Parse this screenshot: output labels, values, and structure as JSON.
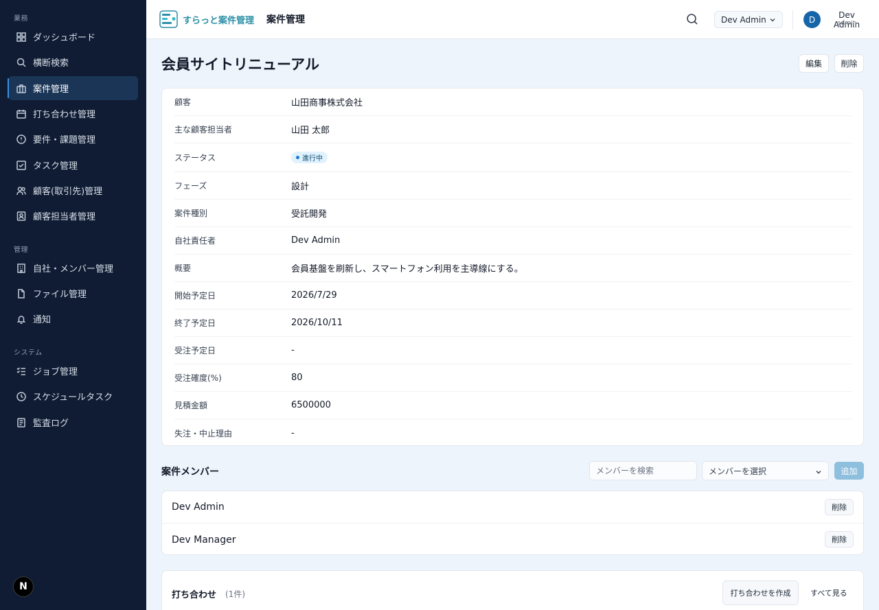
{
  "sidebar": {
    "sections": [
      {
        "label": "業務"
      },
      {
        "label": "管理"
      },
      {
        "label": "システム"
      }
    ],
    "items": [
      {
        "label": "ダッシュボード",
        "icon": "dashboard-icon"
      },
      {
        "label": "横断検索",
        "icon": "search-icon"
      },
      {
        "label": "案件管理",
        "icon": "briefcase-icon",
        "active": true
      },
      {
        "label": "打ち合わせ管理",
        "icon": "calendar-icon"
      },
      {
        "label": "要件・課題管理",
        "icon": "alert-circle-icon"
      },
      {
        "label": "タスク管理",
        "icon": "checkbox-icon"
      },
      {
        "label": "顧客(取引先)管理",
        "icon": "users-icon"
      },
      {
        "label": "顧客担当者管理",
        "icon": "contact-icon"
      },
      {
        "label": "自社・メンバー管理",
        "icon": "building-icon"
      },
      {
        "label": "ファイル管理",
        "icon": "file-icon"
      },
      {
        "label": "通知",
        "icon": "bell-icon"
      },
      {
        "label": "ジョブ管理",
        "icon": "list-check-icon"
      },
      {
        "label": "スケジュールタスク",
        "icon": "clock-icon"
      },
      {
        "label": "監査ログ",
        "icon": "log-icon"
      }
    ],
    "footer_badge": "N"
  },
  "header": {
    "logo_text": "すらっと案件管理",
    "title": "案件管理",
    "user_select": "Dev Admin",
    "avatar_initial": "D",
    "user_name": "Dev Admin",
    "user_role": "admin"
  },
  "page": {
    "title": "会員サイトリニューアル",
    "edit_label": "編集",
    "delete_label": "削除"
  },
  "details": [
    {
      "label": "顧客",
      "value": "山田商事株式会社"
    },
    {
      "label": "主な顧客担当者",
      "value": "山田 太郎"
    },
    {
      "label": "ステータス",
      "value": "進行中",
      "badge": true
    },
    {
      "label": "フェーズ",
      "value": "設計"
    },
    {
      "label": "案件種別",
      "value": "受託開発"
    },
    {
      "label": "自社責任者",
      "value": "Dev Admin"
    },
    {
      "label": "概要",
      "value": "会員基盤を刷新し、スマートフォン利用を主導線にする。"
    },
    {
      "label": "開始予定日",
      "value": "2026/7/29"
    },
    {
      "label": "終了予定日",
      "value": "2026/10/11"
    },
    {
      "label": "受注予定日",
      "value": "-"
    },
    {
      "label": "受注確度(%)",
      "value": "80"
    },
    {
      "label": "見積金額",
      "value": "6500000"
    },
    {
      "label": "失注・中止理由",
      "value": "-"
    }
  ],
  "members": {
    "title": "案件メンバー",
    "search_placeholder": "メンバーを検索",
    "select_placeholder": "メンバーを選択",
    "add_label": "追加",
    "list": [
      {
        "name": "Dev Admin",
        "delete_label": "削除"
      },
      {
        "name": "Dev Manager",
        "delete_label": "削除"
      }
    ]
  },
  "meetings": {
    "title": "打ち合わせ",
    "count": "(1件)",
    "create_label": "打ち合わせを作成",
    "see_all_label": "すべて見る"
  },
  "colors": {
    "sidebar_bg": "#0f1c33",
    "active_item_bg": "#1b3556",
    "accent": "#1565a8",
    "status_badge_bg": "#e0f2fe"
  }
}
